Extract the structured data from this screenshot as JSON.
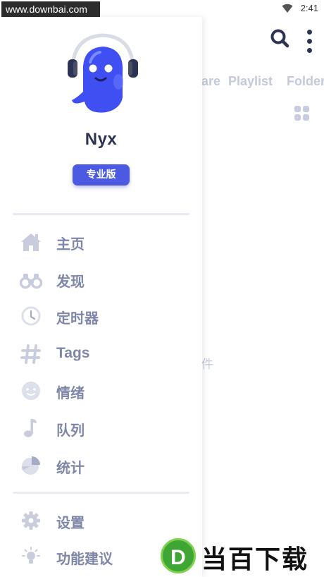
{
  "watermark": {
    "top_text": "www.downbai.com",
    "logo_letter": "D",
    "logo_text": "当百下载"
  },
  "status_bar": {
    "time": "2:41"
  },
  "background_app": {
    "tabs": [
      "are",
      "Playlist",
      "Folder"
    ],
    "empty_text_fragment": "件"
  },
  "drawer": {
    "user_name": "Nyx",
    "badge_label": "专业版",
    "menu": [
      {
        "label": "主页",
        "icon": "home-icon"
      },
      {
        "label": "发现",
        "icon": "binoculars-icon"
      },
      {
        "label": "定时器",
        "icon": "clock-icon"
      },
      {
        "label": "Tags",
        "icon": "hashtag-icon"
      },
      {
        "label": "情绪",
        "icon": "smiley-icon"
      },
      {
        "label": "队列",
        "icon": "music-note-icon"
      },
      {
        "label": "统计",
        "icon": "pie-chart-icon"
      }
    ],
    "bottom_menu": [
      {
        "label": "设置",
        "icon": "gear-icon"
      },
      {
        "label": "功能建议",
        "icon": "lightbulb-icon"
      }
    ]
  },
  "colors": {
    "accent": "#4b5ae0",
    "icon_gray": "#c8ccdd",
    "label_gray": "#7f86a8",
    "dark_text": "#2d3352"
  }
}
